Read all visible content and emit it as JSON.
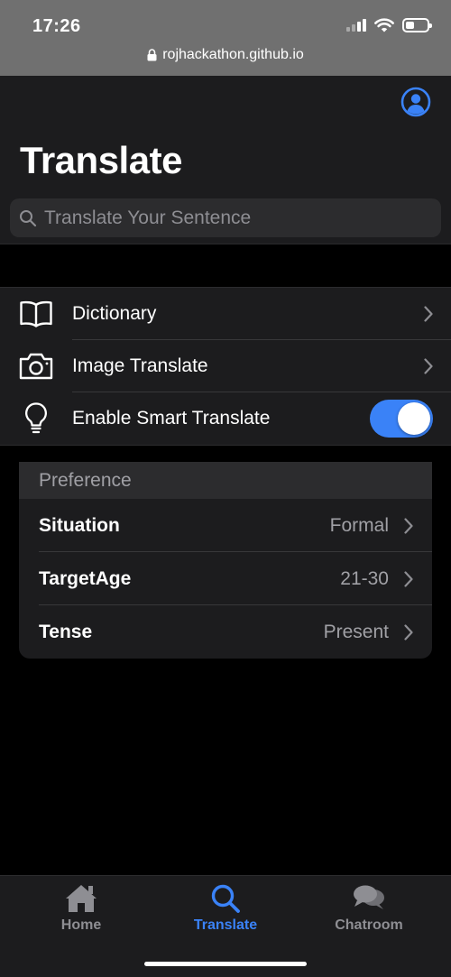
{
  "status_bar": {
    "time": "17:26",
    "url": "rojhackathon.github.io"
  },
  "header": {
    "title": "Translate",
    "profile_icon": "person-circle-icon",
    "search_placeholder": "Translate Your Sentence"
  },
  "menu": {
    "items": [
      {
        "label": "Dictionary",
        "icon": "book-icon",
        "type": "link"
      },
      {
        "label": "Image Translate",
        "icon": "camera-icon",
        "type": "link"
      },
      {
        "label": "Enable Smart Translate",
        "icon": "lightbulb-icon",
        "type": "toggle",
        "enabled": true
      }
    ]
  },
  "preference": {
    "title": "Preference",
    "rows": [
      {
        "label": "Situation",
        "value": "Formal"
      },
      {
        "label": "TargetAge",
        "value": "21-30"
      },
      {
        "label": "Tense",
        "value": "Present"
      }
    ]
  },
  "tabbar": {
    "tabs": [
      {
        "label": "Home",
        "icon": "house-icon",
        "active": false
      },
      {
        "label": "Translate",
        "icon": "magnifier-icon",
        "active": true
      },
      {
        "label": "Chatroom",
        "icon": "chat-bubbles-icon",
        "active": false
      }
    ]
  },
  "colors": {
    "accent": "#3a82f7",
    "background": "#000000",
    "surface": "#1c1c1e",
    "secondary_text": "#a0a0a5"
  }
}
